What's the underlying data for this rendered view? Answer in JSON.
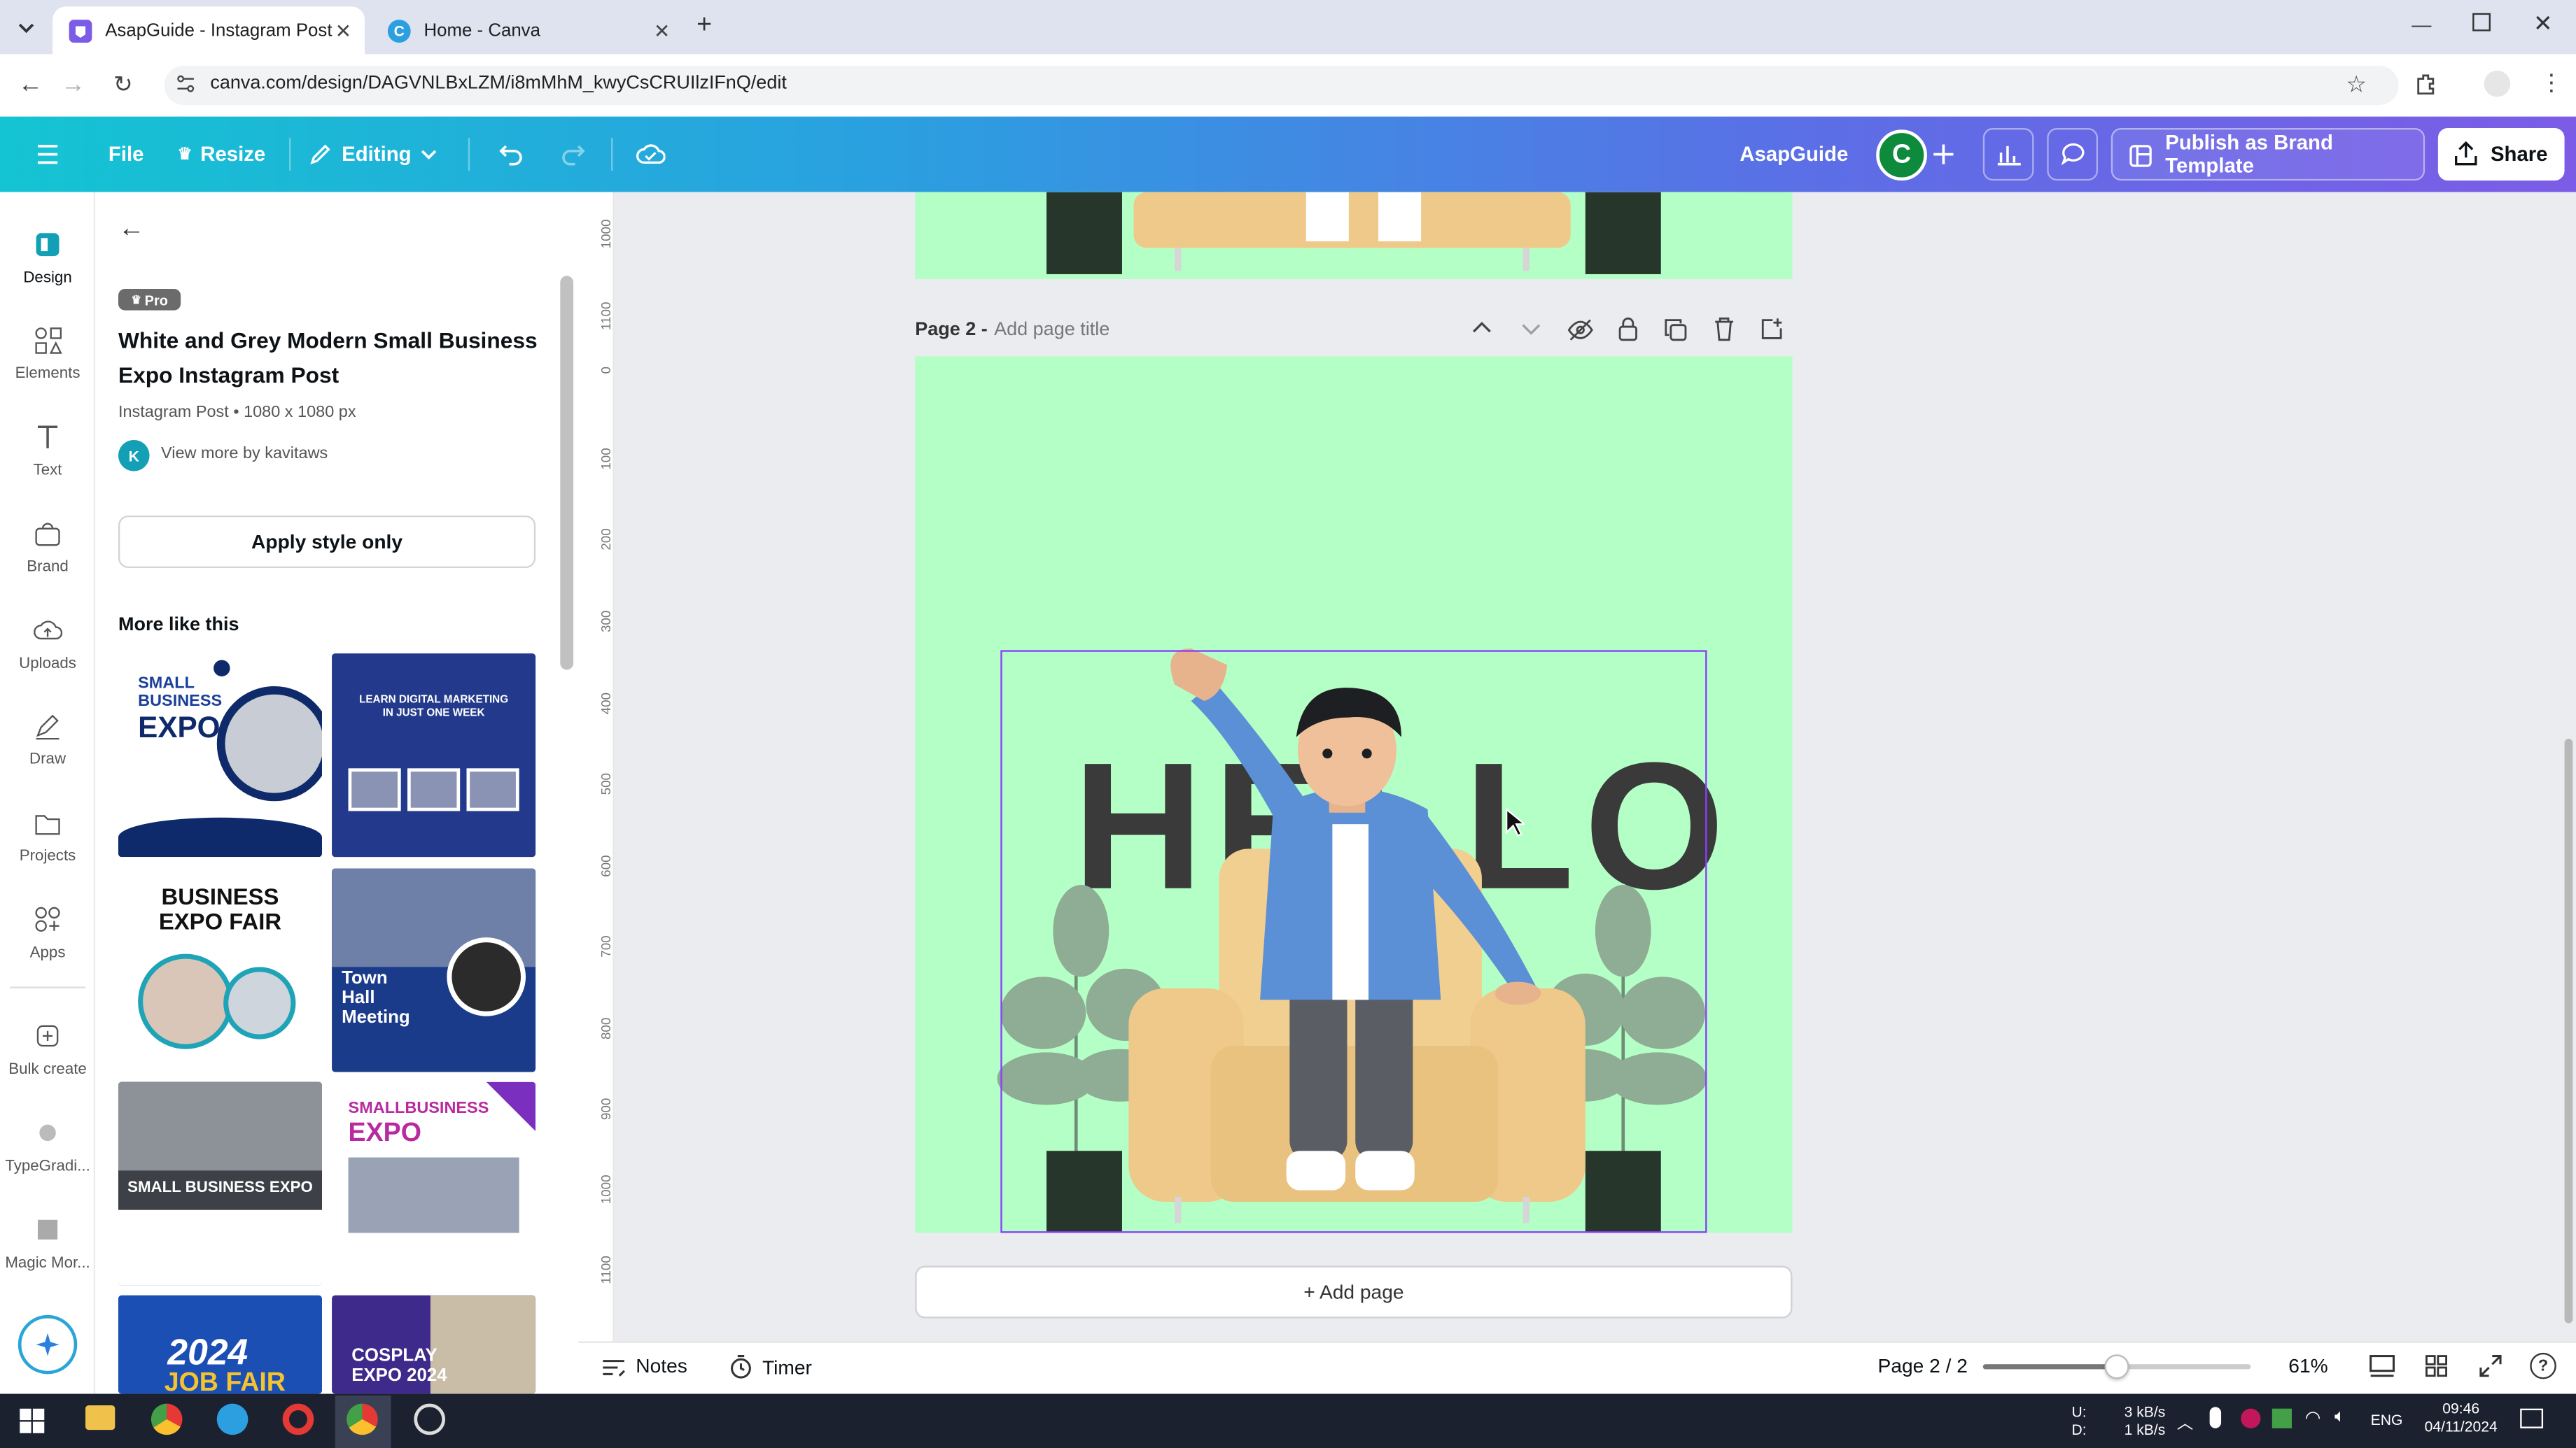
{
  "browser": {
    "tabs": [
      {
        "title": "AsapGuide - Instagram Post"
      },
      {
        "title": "Home - Canva"
      }
    ],
    "url": "canva.com/design/DAGVNLBxLZM/i8mMhM_kwyCsCRUIlzIFnQ/edit"
  },
  "toolbar": {
    "file": "File",
    "resize": "Resize",
    "editing": "Editing",
    "brand_name": "AsapGuide",
    "avatar_letter": "C",
    "publish": "Publish as Brand Template",
    "share": "Share"
  },
  "rail": [
    {
      "label": "Design",
      "icon": "design-icon"
    },
    {
      "label": "Elements",
      "icon": "elements-icon"
    },
    {
      "label": "Text",
      "icon": "text-icon"
    },
    {
      "label": "Brand",
      "icon": "brand-icon"
    },
    {
      "label": "Uploads",
      "icon": "uploads-icon"
    },
    {
      "label": "Draw",
      "icon": "draw-icon"
    },
    {
      "label": "Projects",
      "icon": "projects-icon"
    },
    {
      "label": "Apps",
      "icon": "apps-icon"
    },
    {
      "label": "Bulk create",
      "icon": "bulk-create-icon"
    },
    {
      "label": "TypeGradi...",
      "icon": "typegradient-icon"
    },
    {
      "label": "Magic Mor...",
      "icon": "magic-morph-icon"
    }
  ],
  "panel": {
    "badge": "Pro",
    "title": "White and Grey Modern Small Business Expo Instagram Post",
    "subtitle": "Instagram Post • 1080 x 1080 px",
    "author_initial": "K",
    "view_more": "View more by kavitaws",
    "apply_button": "Apply style only",
    "more_like_this": "More like this",
    "thumbs": [
      {
        "line1": "SMALL",
        "line2": "BUSINESS",
        "line3": "EXPO"
      },
      {
        "line1": "LEARN DIGITAL MARKETING",
        "line2": "IN JUST ONE WEEK"
      },
      {
        "line1": "BUSINESS",
        "line2": "EXPO FAIR"
      },
      {
        "line1": "Town",
        "line2": "Hall",
        "line3": "Meeting"
      },
      {
        "line1": "SMALL BUSINESS EXPO"
      },
      {
        "line1": "SMALLBUSINESS",
        "line2": "EXPO"
      },
      {
        "line1": "2024",
        "line2": "JOB FAIR"
      },
      {
        "line1": "COSPLAY",
        "line2": "EXPO 2024"
      }
    ]
  },
  "ruler_labels": [
    "1000",
    "1100",
    "0",
    "100",
    "200",
    "300",
    "400",
    "500",
    "600",
    "700",
    "800",
    "900",
    "1000",
    "1100"
  ],
  "page2": {
    "label": "Page 2 -",
    "placeholder": "Add page title",
    "hello_text": "HELLO"
  },
  "add_page": "+ Add page",
  "bottom": {
    "notes": "Notes",
    "timer": "Timer",
    "page_indicator": "Page 2 / 2",
    "zoom": "61%",
    "zoom_fraction": 0.61
  },
  "taskbar": {
    "net_up_label": "U:",
    "net_down_label": "D:",
    "net_up": "3 kB/s",
    "net_down": "1 kB/s",
    "lang": "ENG",
    "time": "09:46",
    "date": "04/11/2024"
  },
  "colors": {
    "page_bg": "#b4ffc5",
    "selection": "#8b3dff",
    "header_start": "#14c4d2",
    "header_end": "#7c5ce6"
  }
}
